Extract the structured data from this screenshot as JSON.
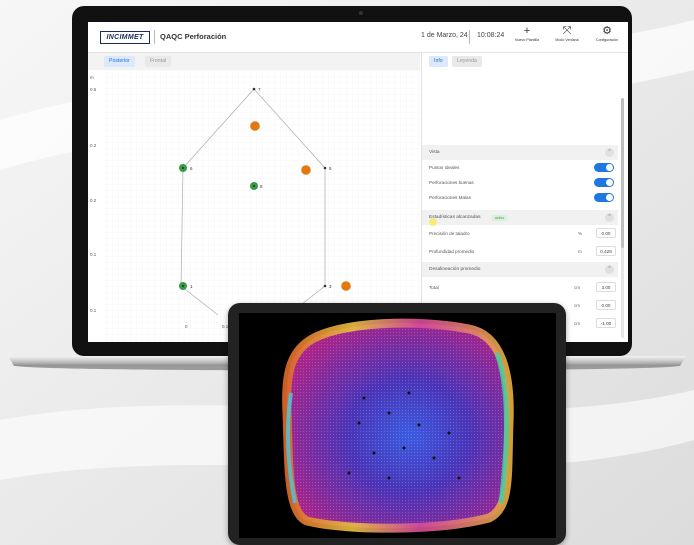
{
  "header": {
    "logo_text": "INCIMMET",
    "app_title": "QAQC Perforación",
    "date": "1 de Marzo, 24",
    "time": "10:08:24",
    "buttons": [
      {
        "label": "Nuevo Plantilla",
        "icon": "plus-icon"
      },
      {
        "label": "Modo Ventana",
        "icon": "expand-icon"
      },
      {
        "label": "Configuración",
        "icon": "gear-icon"
      }
    ]
  },
  "left_panel": {
    "tabs": [
      {
        "label": "Posterior",
        "active": true
      },
      {
        "label": "Frontal",
        "active": false
      }
    ],
    "unit_label": "m",
    "y_ticks": [
      "0.5",
      "0.2",
      "0.2",
      "0.1",
      "0.1"
    ],
    "x_ticks": [
      "0",
      "0.1"
    ],
    "points": [
      {
        "label": "7"
      },
      {
        "label": "6"
      },
      {
        "label": "5"
      },
      {
        "label": "8"
      },
      {
        "label": "1"
      },
      {
        "label": "3"
      }
    ]
  },
  "right_panel": {
    "tabs": [
      {
        "label": "Info",
        "active": true
      },
      {
        "label": "Leyenda",
        "active": false
      }
    ],
    "vista": {
      "title": "Vista",
      "toggles": [
        {
          "label": "Puntos Ideales",
          "on": true
        },
        {
          "label": "Perforaciones buenas",
          "on": true
        },
        {
          "label": "Perforaciones Malas",
          "on": true
        }
      ]
    },
    "estadisticas": {
      "title": "Estadísticas alcanzadas",
      "badge": "activo",
      "rows": [
        {
          "label": "Precisión de taladro",
          "unit": "%",
          "value": "0.00"
        },
        {
          "label": "Profundidad promedio",
          "unit": "m",
          "value": "0.428"
        }
      ]
    },
    "desalineacion": {
      "title": "Desalineación promedio",
      "rows": [
        {
          "label": "Total",
          "unit": "cm",
          "value": "3.00"
        },
        {
          "label": "Horizontal",
          "unit": "cm",
          "value": "0.00"
        },
        {
          "label": "Vertical",
          "unit": "cm",
          "value": "-1.00"
        }
      ]
    }
  },
  "colors": {
    "accent": "#1e78e0",
    "good_point": "#3a9a4a",
    "bad_point": "#e07a10",
    "ideal_point": "#333333"
  }
}
